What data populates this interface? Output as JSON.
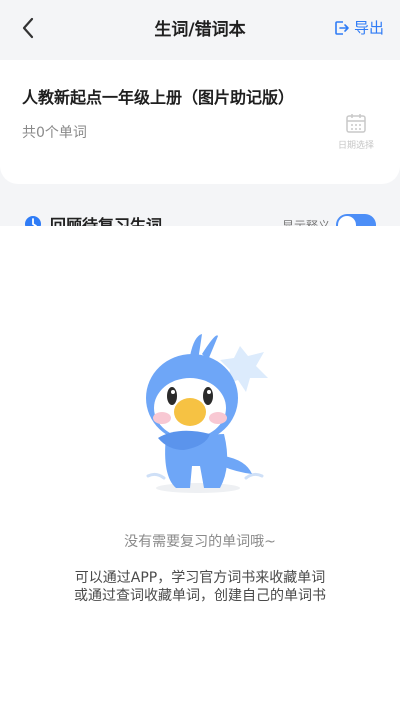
{
  "header": {
    "title": "生词/错词本",
    "export_label": "导出"
  },
  "book": {
    "title": "人教新起点一年级上册（图片助记版）",
    "word_count": "共0个单词",
    "date_label": "日期选择"
  },
  "review": {
    "label": "回顾待复习生词",
    "meaning_label": "显示释义"
  },
  "empty": {
    "title": "没有需要复习的单词哦~",
    "desc_line1": "可以通过APP，学习官方词书来收藏单词",
    "desc_line2": "或通过查词收藏单词，创建自己的单词书"
  },
  "colors": {
    "accent": "#2f7cf6",
    "mascot": "#6ea6f7"
  }
}
